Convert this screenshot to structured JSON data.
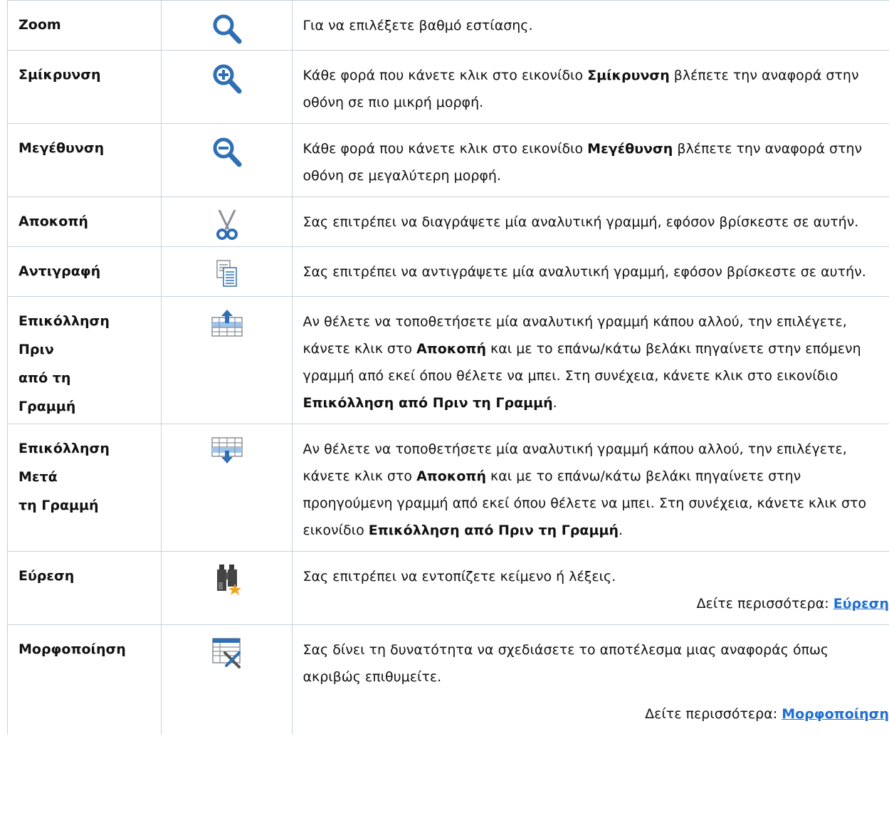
{
  "rows": [
    {
      "name": [
        "Zoom"
      ],
      "icon": "zoom-icon",
      "desc": [
        {
          "t": "Για να επιλέξετε βαθμό εστίασης."
        }
      ]
    },
    {
      "name": [
        "Σμίκρυνση"
      ],
      "icon": "zoom-in-icon",
      "desc": [
        {
          "t": "Κάθε φορά που κάνετε κλικ στο εικονίδιο "
        },
        {
          "t": "Σμίκρυνση",
          "b": true
        },
        {
          "t": " βλέπετε την αναφορά στην οθόνη σε πιο μικρή μορφή."
        }
      ]
    },
    {
      "name": [
        "Μεγέθυνση"
      ],
      "icon": "zoom-out-icon",
      "desc": [
        {
          "t": "Κάθε φορά που κάνετε κλικ στο εικονίδιο "
        },
        {
          "t": "Μεγέθυνση",
          "b": true
        },
        {
          "t": " βλέπετε την αναφορά στην οθόνη σε μεγαλύτερη μορφή."
        }
      ]
    },
    {
      "name": [
        "Αποκοπή"
      ],
      "icon": "scissors-icon",
      "desc": [
        {
          "t": "Σας επιτρέπει να διαγράψετε μία αναλυτική γραμμή, εφόσον βρίσκεστε σε αυτήν."
        }
      ]
    },
    {
      "name": [
        "Αντιγραφή"
      ],
      "icon": "copy-icon",
      "desc": [
        {
          "t": "Σας επιτρέπει να αντιγράψετε μία αναλυτική γραμμή, εφόσον βρίσκεστε σε αυτήν."
        }
      ]
    },
    {
      "name": [
        "Επικόλληση",
        "Πριν",
        "από τη",
        "Γραμμή"
      ],
      "icon": "paste-before-icon",
      "desc": [
        {
          "t": "Αν θέλετε να τοποθετήσετε μία αναλυτική γραμμή κάπου αλλού, την επιλέγετε, κάνετε κλικ στο "
        },
        {
          "t": "Αποκοπή",
          "b": true
        },
        {
          "t": " και με το επάνω/κάτω βελάκι πηγαίνετε στην επόμενη γραμμή από εκεί όπου θέλετε να μπει. Στη συνέχεια, κάνετε κλικ στο εικονίδιο "
        },
        {
          "t": "Επικόλληση από Πριν τη Γραμμή",
          "b": true
        },
        {
          "t": "."
        }
      ]
    },
    {
      "name": [
        "Επικόλληση",
        "Μετά",
        "τη Γραμμή"
      ],
      "icon": "paste-after-icon",
      "desc": [
        {
          "t": "Αν θέλετε να τοποθετήσετε μία αναλυτική γραμμή κάπου αλλού, την επιλέγετε, κάνετε κλικ στο "
        },
        {
          "t": "Αποκοπή",
          "b": true
        },
        {
          "t": " και με το επάνω/κάτω βελάκι πηγαίνετε στην προηγούμενη γραμμή από εκεί όπου θέλετε να μπει. Στη συνέχεια, κάνετε κλικ στο εικονίδιο "
        },
        {
          "t": "Επικόλληση από Πριν τη Γραμμή",
          "b": true
        },
        {
          "t": "."
        }
      ]
    },
    {
      "name": [
        "Εύρεση"
      ],
      "icon": "binoculars-icon",
      "desc": [
        {
          "t": "Σας επιτρέπει να εντοπίζετε κείμενο ή λέξεις."
        }
      ],
      "more": {
        "label": "Δείτε περισσότερα: ",
        "link": "Εύρεση"
      }
    },
    {
      "name": [
        "Μορφοποίηση"
      ],
      "icon": "format-tools-icon",
      "desc": [
        {
          "t": "Σας δίνει τη δυνατότητα να σχεδιάσετε το αποτέλεσμα μιας αναφοράς όπως ακριβώς επιθυμείτε."
        }
      ],
      "more": {
        "label": "Δείτε περισσότερα: ",
        "link": "Μορφοποίηση"
      }
    }
  ],
  "colors": {
    "icon_blue": "#2f6fb5",
    "link": "#1f6fd1",
    "border": "#c9d1db"
  }
}
